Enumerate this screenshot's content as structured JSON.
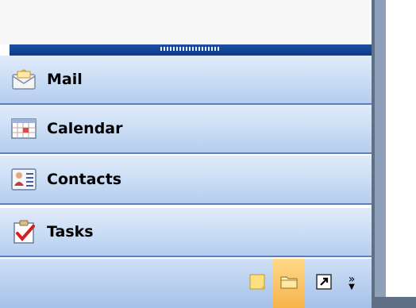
{
  "nav": {
    "buttons": [
      {
        "label": "Mail",
        "icon": "mail-icon"
      },
      {
        "label": "Calendar",
        "icon": "calendar-icon"
      },
      {
        "label": "Contacts",
        "icon": "contacts-icon"
      },
      {
        "label": "Tasks",
        "icon": "tasks-icon"
      }
    ]
  },
  "toolbar": {
    "icons": [
      "notes-icon",
      "folder-list-icon",
      "shortcuts-icon",
      "configure-buttons-icon"
    ],
    "more_glyph": "»"
  },
  "colors": {
    "splitter": "#1d4fa2",
    "button_gradient_top": "#e1ebf9",
    "button_gradient_bottom": "#b6cdee",
    "selected_highlight": "#f7b34a",
    "border": "#5b7fc3"
  }
}
